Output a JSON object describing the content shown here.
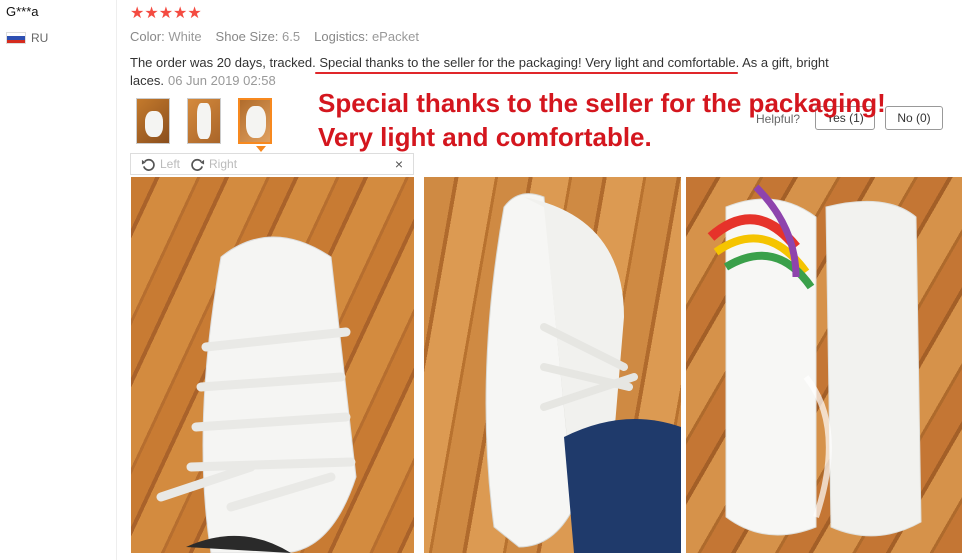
{
  "reviewer": {
    "name": "G***a",
    "country_code": "RU"
  },
  "rating": {
    "stars": 5,
    "star_glyphs": "★★★★★",
    "color": "#f44b41"
  },
  "attributes": {
    "color_label": "Color:",
    "color_value": "White",
    "size_label": "Shoe Size:",
    "size_value": "6.5",
    "logistics_label": "Logistics:",
    "logistics_value": "ePacket"
  },
  "review": {
    "text_before": "The order was 20 days, tracked. ",
    "text_highlight": "Special thanks to the seller for the packaging! Very light and comfortable",
    "text_after": ". As a gift, bright laces.",
    "date": "06 Jun 2019 02:58"
  },
  "thumbnails": [
    {
      "name": "thumbnail-1",
      "active": false
    },
    {
      "name": "thumbnail-2",
      "active": false
    },
    {
      "name": "thumbnail-3",
      "active": true
    }
  ],
  "rotate_toolbar": {
    "left_label": "Left",
    "right_label": "Right",
    "close_glyph": "×"
  },
  "overlay_caption": {
    "line1": "Special thanks to the seller for the packaging!",
    "line2": "Very light and comfortable.",
    "color": "#d4161e"
  },
  "helpful": {
    "label": "Helpful?",
    "yes_label": "Yes (1)",
    "no_label": "No (0)"
  },
  "photos": [
    {
      "name": "photo-shoe-top-view"
    },
    {
      "name": "photo-shoe-side-view"
    },
    {
      "name": "photo-shoes-in-packaging"
    }
  ]
}
